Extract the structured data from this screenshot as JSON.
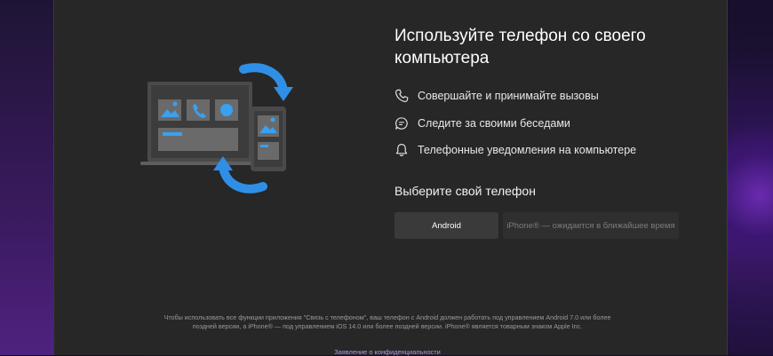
{
  "window": {
    "title": "Используйте телефон со своего компьютера"
  },
  "illustration": {
    "name": "phone-pc-sync-illustration",
    "colors": {
      "arrow": "#2f8fe6",
      "laptop": "#565656",
      "tile": "#6a6a6a",
      "accent": "#3aa0f0"
    }
  },
  "features": [
    {
      "icon": "phone-icon",
      "label": "Совершайте и принимайте вызовы"
    },
    {
      "icon": "chat-icon",
      "label": "Следите за своими беседами"
    },
    {
      "icon": "bell-icon",
      "label": "Телефонные уведомления на компьютере"
    }
  ],
  "choose_phone": {
    "heading": "Выберите свой телефон",
    "android_label": "Android",
    "iphone_label": "iPhone® — ожидается в ближайшее время"
  },
  "footer": {
    "notice": "Чтобы использовать все функции приложения \"Связь с телефоном\", ваш телефон с Android должен работать под управлением Android 7.0 или более поздней версии, а iPhone® — под управлением iOS 14.0 или более поздней версии. iPhone® является товарным знаком Apple Inc.",
    "privacy_link": "Заявление о конфиденциальности"
  },
  "colors": {
    "window_bg": "#272727",
    "link": "#b596e8",
    "android_button_bg": "#3a3a3a",
    "iphone_button_bg": "#2f2f2f"
  }
}
